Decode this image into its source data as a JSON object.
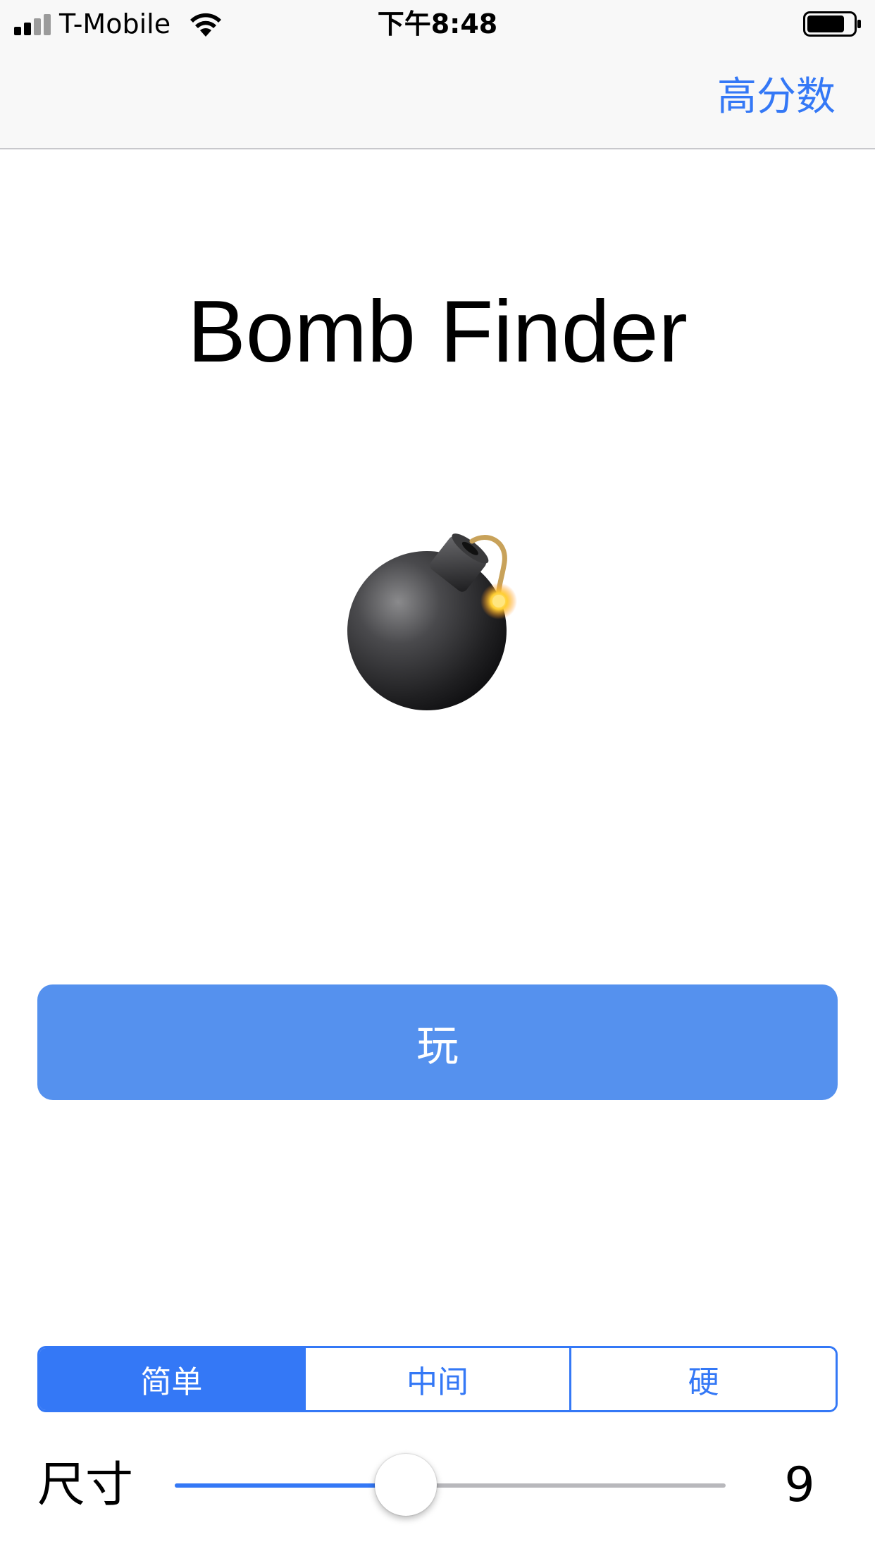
{
  "status_bar": {
    "carrier": "T-Mobile",
    "time": "下午8:48"
  },
  "nav": {
    "high_score_label": "高分数"
  },
  "main": {
    "title": "Bomb Finder",
    "image_icon": "bomb-emoji",
    "play_label": "玩"
  },
  "difficulty": {
    "selected_index": 0,
    "options": [
      {
        "label": "简单"
      },
      {
        "label": "中间"
      },
      {
        "label": "硬"
      }
    ]
  },
  "size": {
    "label": "尺寸",
    "value": "9",
    "slider_fraction": 0.42
  },
  "colors": {
    "accent": "#3478f6",
    "play_button": "#5591ee"
  }
}
